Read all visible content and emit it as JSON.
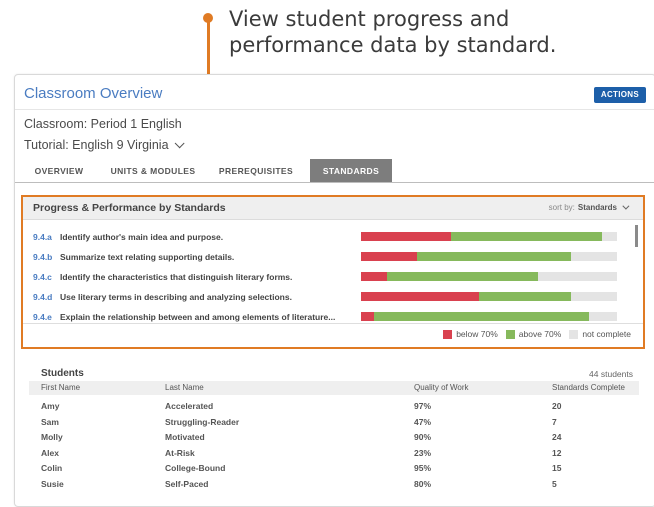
{
  "callout": {
    "line1": "View student progress and",
    "line2": "performance data by standard."
  },
  "header": {
    "title": "Classroom Overview",
    "actions_label": "ACTIONS",
    "classroom": "Classroom: Period 1 English",
    "tutorial": "Tutorial: English 9 Virginia"
  },
  "tabs": [
    {
      "label": "OVERVIEW",
      "active": false
    },
    {
      "label": "UNITS & MODULES",
      "active": false
    },
    {
      "label": "PREREQUISITES",
      "active": false
    },
    {
      "label": "STANDARDS",
      "active": true
    }
  ],
  "standards": {
    "title": "Progress & Performance by Standards",
    "sort_label": "sort by:",
    "sort_value": "Standards",
    "rows": [
      {
        "code": "9.4.a",
        "desc": "Identify author's main idea and purpose.",
        "below": 0.35,
        "above": 0.59
      },
      {
        "code": "9.4.b",
        "desc": "Summarize text relating supporting details.",
        "below": 0.22,
        "above": 0.6
      },
      {
        "code": "9.4.c",
        "desc": "Identify the characteristics that distinguish literary forms.",
        "below": 0.1,
        "above": 0.59
      },
      {
        "code": "9.4.d",
        "desc": "Use literary terms in describing and analyzing selections.",
        "below": 0.46,
        "above": 0.36
      },
      {
        "code": "9.4.e",
        "desc": "Explain the relationship between and among elements of literature...",
        "below": 0.05,
        "above": 0.84
      }
    ],
    "legend": {
      "below": "below 70%",
      "above": "above 70%",
      "not_complete": "not complete"
    },
    "colors": {
      "below": "#d9414f",
      "above": "#86b95c",
      "not_complete": "#e4e4e4"
    }
  },
  "students": {
    "title": "Students",
    "count": "44 students",
    "columns": [
      "First Name",
      "Last Name",
      "Quality of Work",
      "Standards Complete"
    ],
    "rows": [
      [
        "Amy",
        "Accelerated",
        "97%",
        "20"
      ],
      [
        "Sam",
        "Struggling-Reader",
        "47%",
        "7"
      ],
      [
        "Molly",
        "Motivated",
        "90%",
        "24"
      ],
      [
        "Alex",
        "At-Risk",
        "23%",
        "12"
      ],
      [
        "Colin",
        "College-Bound",
        "95%",
        "15"
      ],
      [
        "Susie",
        "Self-Paced",
        "80%",
        "5"
      ]
    ]
  },
  "colors": {
    "accent": "#e07b24",
    "link": "#4a7cc1",
    "button": "#1d5fa9"
  }
}
